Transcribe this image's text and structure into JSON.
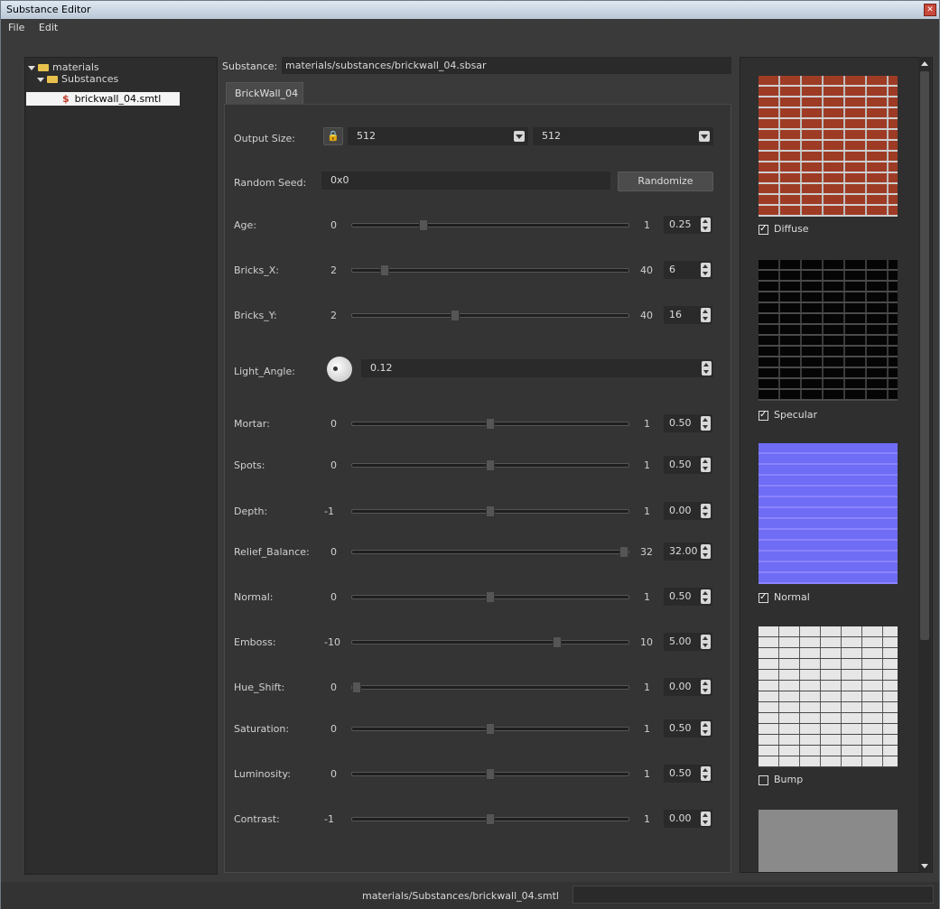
{
  "window": {
    "title": "Substance Editor"
  },
  "menu": {
    "file": "File",
    "edit": "Edit"
  },
  "tree": {
    "items": [
      {
        "label": "materials"
      },
      {
        "label": "Substances"
      },
      {
        "label": "brickwall_04.smtl"
      }
    ]
  },
  "substance": {
    "label": "Substance:",
    "path": "materials/substances/brickwall_04.sbsar"
  },
  "tab": {
    "label": "BrickWall_04"
  },
  "output_size": {
    "label": "Output Size:",
    "width": "512",
    "height": "512"
  },
  "random_seed": {
    "label": "Random Seed:",
    "value": "0x0",
    "button": "Randomize"
  },
  "params": [
    {
      "label": "Age:",
      "min": "0",
      "max": "1",
      "value": "0.25",
      "fraction": 0.25
    },
    {
      "label": "Bricks_X:",
      "min": "2",
      "max": "40",
      "value": "6",
      "fraction": 0.105
    },
    {
      "label": "Bricks_Y:",
      "min": "2",
      "max": "40",
      "value": "16",
      "fraction": 0.368
    },
    {
      "label": "Mortar:",
      "min": "0",
      "max": "1",
      "value": "0.50",
      "fraction": 0.5
    },
    {
      "label": "Spots:",
      "min": "0",
      "max": "1",
      "value": "0.50",
      "fraction": 0.5
    },
    {
      "label": "Depth:",
      "min": "-1",
      "max": "1",
      "value": "0.00",
      "fraction": 0.5
    },
    {
      "label": "Relief_Balance:",
      "min": "0",
      "max": "32",
      "value": "32.00",
      "fraction": 1.0
    },
    {
      "label": "Normal:",
      "min": "0",
      "max": "1",
      "value": "0.50",
      "fraction": 0.5
    },
    {
      "label": "Emboss:",
      "min": "-10",
      "max": "10",
      "value": "5.00",
      "fraction": 0.75
    },
    {
      "label": "Hue_Shift:",
      "min": "0",
      "max": "1",
      "value": "0.00",
      "fraction": 0.0
    },
    {
      "label": "Saturation:",
      "min": "0",
      "max": "1",
      "value": "0.50",
      "fraction": 0.5
    },
    {
      "label": "Luminosity:",
      "min": "0",
      "max": "1",
      "value": "0.50",
      "fraction": 0.5
    },
    {
      "label": "Contrast:",
      "min": "-1",
      "max": "1",
      "value": "0.00",
      "fraction": 0.5
    }
  ],
  "light_angle": {
    "label": "Light_Angle:",
    "value": "0.12"
  },
  "outputs": [
    {
      "label": "Diffuse",
      "checked": true
    },
    {
      "label": "Specular",
      "checked": true
    },
    {
      "label": "Normal",
      "checked": true
    },
    {
      "label": "Bump",
      "checked": false
    }
  ],
  "status": {
    "text": "materials/Substances/brickwall_04.smtl"
  }
}
